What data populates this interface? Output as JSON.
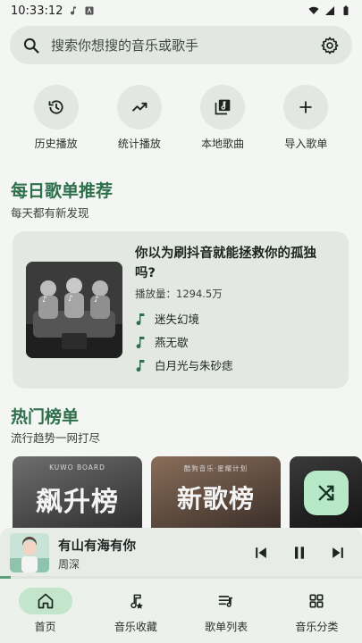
{
  "status_bar": {
    "time": "10:33:12"
  },
  "search": {
    "placeholder": "搜索你想搜的音乐或歌手"
  },
  "quick_actions": [
    {
      "label": "历史播放",
      "icon": "history-icon"
    },
    {
      "label": "统计播放",
      "icon": "trending-icon"
    },
    {
      "label": "本地歌曲",
      "icon": "library-music-icon"
    },
    {
      "label": "导入歌单",
      "icon": "add-icon"
    }
  ],
  "daily": {
    "title": "每日歌单推荐",
    "subtitle": "每天都有新发现",
    "playlist_title": "你以为刷抖音就能拯救你的孤独吗?",
    "plays": "播放量：1294.5万",
    "tracks": [
      "迷失幻境",
      "燕无歇",
      "白月光与朱砂痣"
    ]
  },
  "charts": {
    "title": "热门榜单",
    "subtitle": "流行趋势一网打尽",
    "cards": [
      {
        "brand": "KUWO BOARD",
        "name": "飙升榜"
      },
      {
        "brand": "酷狗音乐·星耀计划",
        "name": "新歌榜"
      }
    ]
  },
  "player": {
    "song": "有山有海有你",
    "artist": "周深",
    "progress": 0.03
  },
  "nav": [
    {
      "label": "首页",
      "icon": "home-icon",
      "active": true
    },
    {
      "label": "音乐收藏",
      "icon": "music-collection-icon",
      "active": false
    },
    {
      "label": "歌单列表",
      "icon": "playlist-icon",
      "active": false
    },
    {
      "label": "音乐分类",
      "icon": "category-icon",
      "active": false
    }
  ],
  "colors": {
    "accent": "#2f6f4d",
    "nav_active": "#c2e5cc",
    "fab": "#b7e9c9",
    "background": "#f3f6f2"
  }
}
